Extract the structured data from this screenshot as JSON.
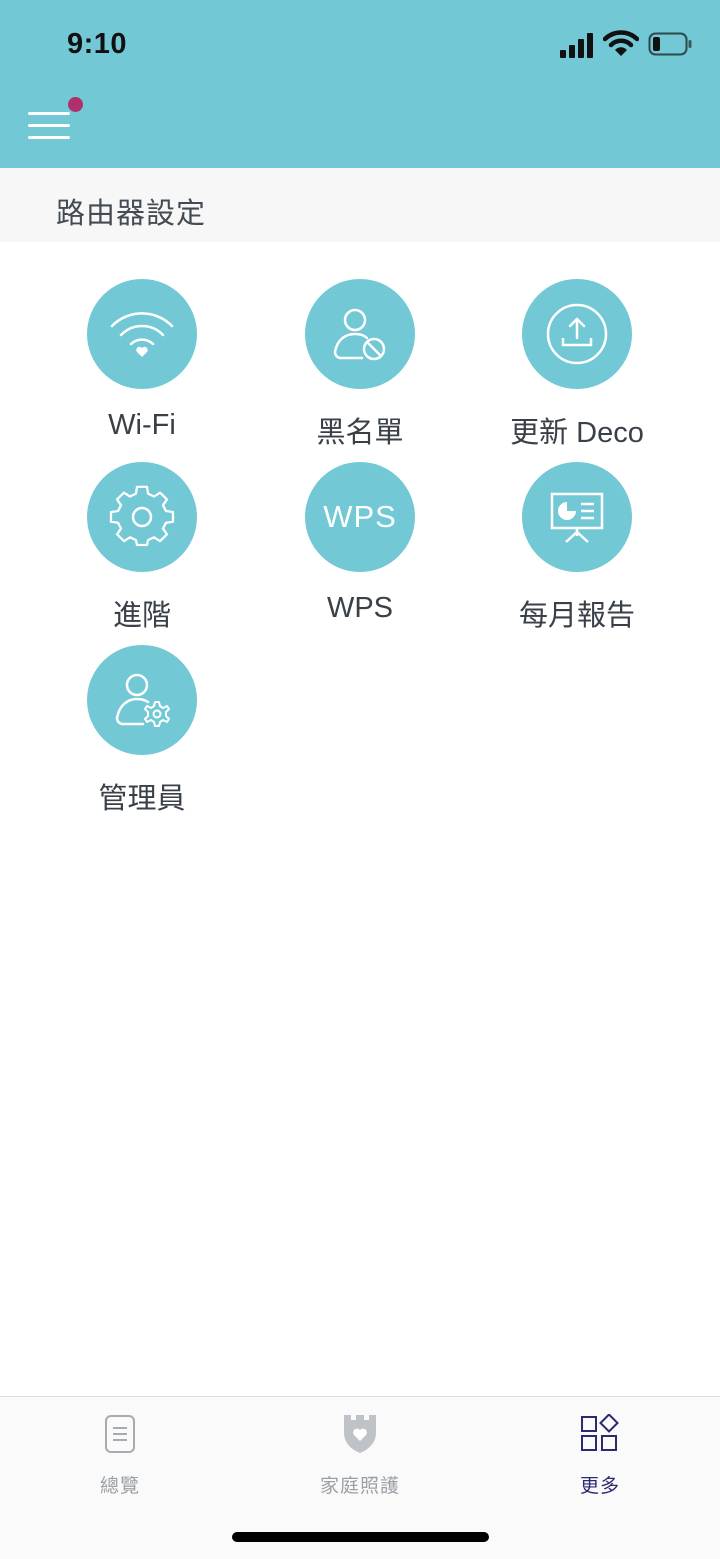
{
  "status_bar": {
    "time": "9:10"
  },
  "section": {
    "title": "路由器設定"
  },
  "tiles": [
    {
      "label": "Wi-Fi",
      "icon": "wifi-heart-icon"
    },
    {
      "label": "黑名單",
      "icon": "user-blocked-icon"
    },
    {
      "label": "更新 Deco",
      "icon": "upload-update-icon"
    },
    {
      "label": "進階",
      "icon": "gear-icon"
    },
    {
      "label": "WPS",
      "icon": "wps-icon",
      "icon_text": "WPS"
    },
    {
      "label": "每月報告",
      "icon": "presentation-report-icon"
    },
    {
      "label": "管理員",
      "icon": "user-gear-icon"
    }
  ],
  "tabbar": {
    "tabs": [
      {
        "label": "總覽",
        "icon": "document-icon",
        "active": false
      },
      {
        "label": "家庭照護",
        "icon": "shield-heart-icon",
        "active": false
      },
      {
        "label": "更多",
        "icon": "grid-diamond-icon",
        "active": true
      }
    ]
  },
  "colors": {
    "accent": "#72c8d4",
    "notification": "#b0306e",
    "active_tab": "#2c2a6e"
  }
}
